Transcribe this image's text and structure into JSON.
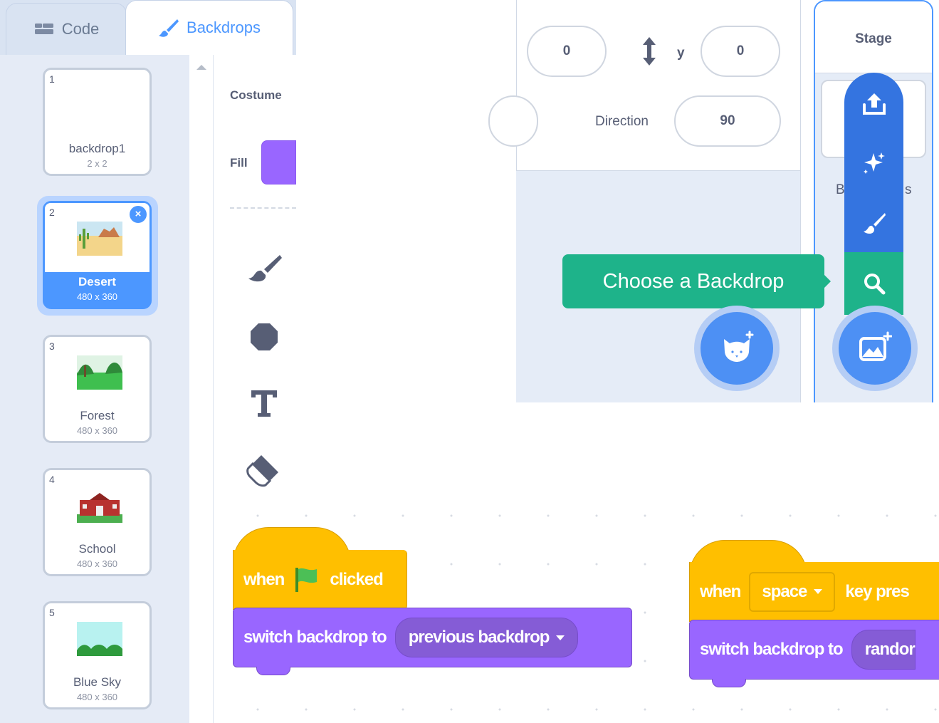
{
  "tabs": {
    "code": "Code",
    "backdrops": "Backdrops"
  },
  "backdrops": [
    {
      "num": "1",
      "name": "backdrop1",
      "size": "2 x 2"
    },
    {
      "num": "2",
      "name": "Desert",
      "size": "480 x 360"
    },
    {
      "num": "3",
      "name": "Forest",
      "size": "480 x 360"
    },
    {
      "num": "4",
      "name": "School",
      "size": "480 x 360"
    },
    {
      "num": "5",
      "name": "Blue Sky",
      "size": "480 x 360"
    }
  ],
  "delete_icon": "×",
  "paint": {
    "costume_label": "Costume",
    "fill_label": "Fill",
    "fill_color": "#9966ff"
  },
  "tools": [
    "brush-icon",
    "circle-icon",
    "text-icon",
    "eraser-icon"
  ],
  "sprite_info": {
    "x_value": "0",
    "y_label": "y",
    "y_value": "0",
    "direction_label": "Direction",
    "direction_value": "90"
  },
  "stage": {
    "title": "Stage",
    "backdrops_partial_left": "B",
    "backdrops_partial_right": "s"
  },
  "tooltip": "Choose a Backdrop",
  "scripts": {
    "s1": {
      "when": "when",
      "clicked": "clicked",
      "switch": "switch backdrop to",
      "option": "previous backdrop"
    },
    "s2": {
      "when": "when",
      "key": "space",
      "key_pressed": "key pres",
      "switch": "switch backdrop to",
      "option": "randor"
    }
  },
  "colors": {
    "accent": "#4c97ff",
    "motion_blue": "#3474e0",
    "green": "#1eb38a",
    "events": "#ffbf00",
    "looks": "#9966ff"
  }
}
